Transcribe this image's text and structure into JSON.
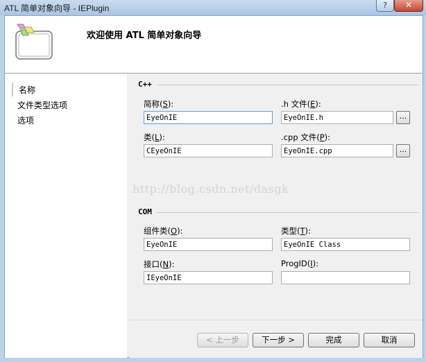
{
  "window": {
    "title": "ATL 简单对象向导 - IEPlugin",
    "close_glyph": "✕",
    "help_glyph": "?"
  },
  "header": {
    "title": "欢迎使用 ATL 简单对象向导"
  },
  "nav": {
    "items": [
      {
        "label": "名称"
      },
      {
        "label": "文件类型选项"
      },
      {
        "label": "选项"
      }
    ]
  },
  "cpp_group": {
    "label": "C++",
    "short_name": {
      "label": "简称",
      "key": "S",
      "value": "EyeOnIE"
    },
    "h_file": {
      "label": ".h 文件",
      "key": "E",
      "value": "EyeOnIE.h"
    },
    "class_name": {
      "label": "类",
      "key": "L",
      "value": "CEyeOnIE"
    },
    "cpp_file": {
      "label": ".cpp 文件",
      "key": "P",
      "value": "EyeOnIE.cpp"
    },
    "browse_label": "..."
  },
  "com_group": {
    "label": "COM",
    "coclass": {
      "label": "组件类",
      "key": "O",
      "value": "EyeOnIE"
    },
    "type": {
      "label": "类型",
      "key": "T",
      "value": "EyeOnIE Class"
    },
    "interface": {
      "label": "接口",
      "key": "N",
      "value": "IEyeOnIE"
    },
    "progid": {
      "label": "ProgID",
      "key": "I",
      "value": ""
    }
  },
  "watermark": "http://blog.csdn.net/dasgk",
  "buttons": {
    "prev": "< 上一步",
    "next": "下一步 >",
    "finish": "完成",
    "cancel": "取消"
  }
}
